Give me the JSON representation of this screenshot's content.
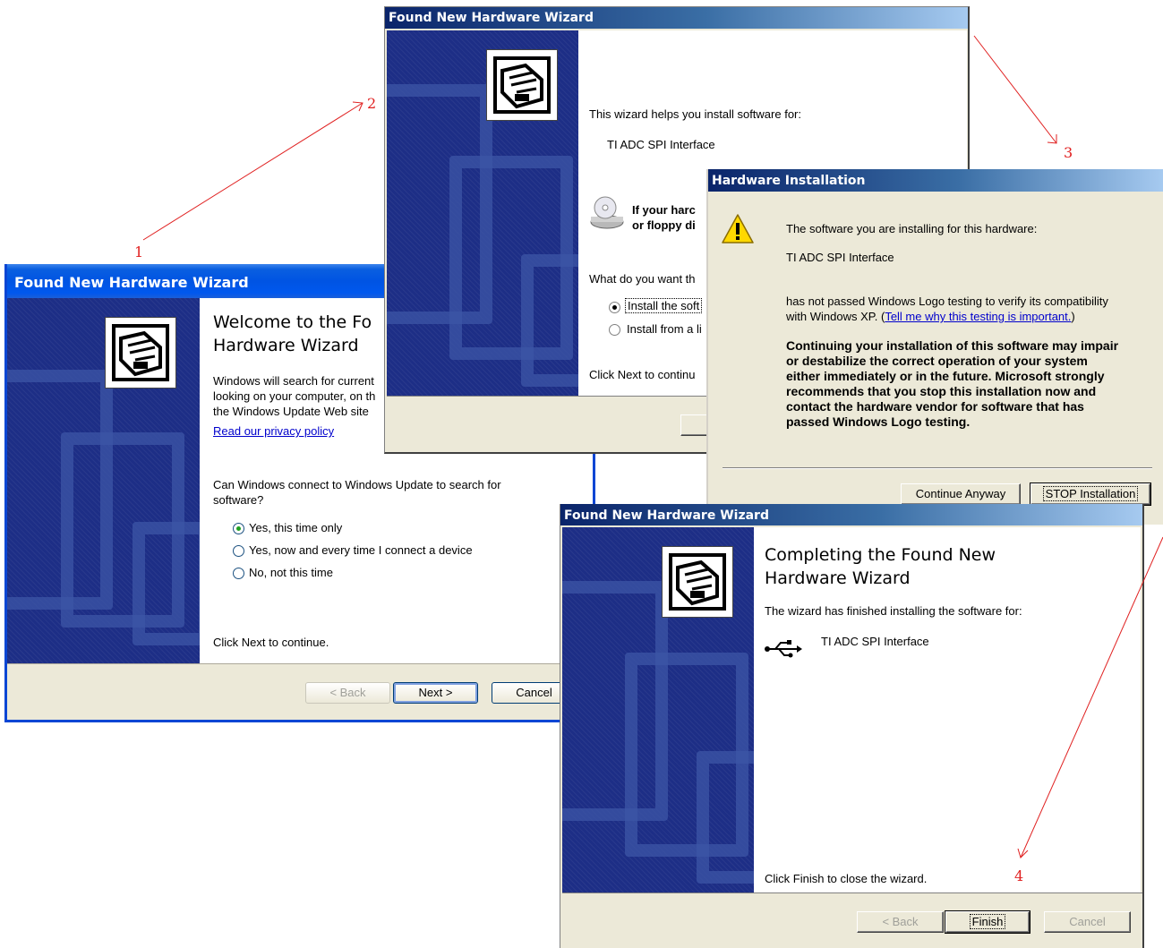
{
  "annotations": {
    "step1": "1",
    "step2": "2",
    "step3": "3",
    "step4": "4"
  },
  "win1": {
    "title": "Found New Hardware Wizard",
    "heading": "Welcome to the Fo\nHardware Wizard",
    "intro_line1": "Windows will search for current",
    "intro_line2": "looking on your computer, on th",
    "intro_line3": "the Windows Update Web site",
    "privacy_link": "Read our privacy policy",
    "question": "Can Windows connect to Windows Update to search for\nsoftware?",
    "options": [
      "Yes, this time only",
      "Yes, now and every time I connect a device",
      "No, not this time"
    ],
    "selected_option": 0,
    "instruction": "Click Next to continue.",
    "back_label": "< Back",
    "next_label": "Next >",
    "cancel_label": "Cancel"
  },
  "win2": {
    "title": "Found New Hardware Wizard",
    "intro": "This wizard helps you install software for:",
    "device": "TI ADC SPI Interface",
    "cd_text": "If your harc\nor floppy di",
    "question": "What do you want th",
    "options": [
      "Install the soft",
      "Install from a li"
    ],
    "instruction": "Click Next to continu"
  },
  "win3": {
    "title": "Hardware Installation",
    "line1": "The software you are installing for this hardware:",
    "device": "TI ADC SPI Interface",
    "line2a": "has not passed Windows Logo testing to verify its compatibility",
    "line2b": "with Windows XP. ",
    "link": "Tell me why this testing is important.",
    "warning": "Continuing your installation of this software may impair\nor destabilize the correct operation of your system\neither immediately or in the future. Microsoft strongly\nrecommends that you stop this installation now and\ncontact the hardware vendor for software that has\npassed Windows Logo testing.",
    "continue_label": "Continue Anyway",
    "stop_label": "STOP Installation"
  },
  "win4": {
    "title": "Found New Hardware Wizard",
    "heading": "Completing the Found New\nHardware Wizard",
    "line1": "The wizard has finished installing the software for:",
    "device": "TI ADC SPI Interface",
    "instruction": "Click Finish to close the wizard.",
    "back_label": "< Back",
    "finish_label": "Finish",
    "cancel_label": "Cancel"
  },
  "colors": {
    "annotation": "#e02020",
    "xp_title": "#0054e3",
    "side_panel": "#1d2e86"
  },
  "icons": [
    "hardware-wizard-icon",
    "cd-drive-icon",
    "warning-icon",
    "usb-icon"
  ]
}
